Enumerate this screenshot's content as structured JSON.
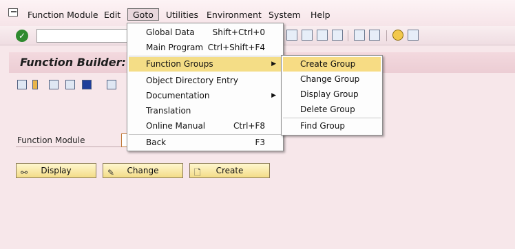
{
  "menubar": {
    "items": [
      {
        "label": "Function Module",
        "accel": "F",
        "rest": "unction Module"
      },
      {
        "label": "Edit",
        "accel": "E",
        "rest": "dit"
      },
      {
        "label": "Goto",
        "accel": "G",
        "rest": "oto"
      },
      {
        "label": "Utilities",
        "accel": "U",
        "rest": "tilities"
      },
      {
        "label": "Environment",
        "accel": "n",
        "pre": "E",
        "rest": "vironment"
      },
      {
        "label": "System",
        "accel": "S",
        "rest": "ystem"
      },
      {
        "label": "Help",
        "accel": "H",
        "rest": "elp"
      }
    ]
  },
  "page": {
    "title": "Function Builder: "
  },
  "form": {
    "function_module_label": "Function Module",
    "function_module_value": ""
  },
  "buttons": {
    "display": "Display",
    "change": "Change",
    "create": "Create"
  },
  "goto_menu": {
    "items": [
      {
        "label": "Global Data",
        "shortcut": "Shift+Ctrl+0"
      },
      {
        "label": "Main Program",
        "shortcut": "Ctrl+Shift+F4"
      },
      {
        "label": "Function Groups",
        "shortcut": "",
        "submenu": true
      },
      {
        "label": "Object Directory Entry",
        "shortcut": ""
      },
      {
        "label": "Documentation",
        "shortcut": "",
        "submenu": true
      },
      {
        "label": "Translation",
        "shortcut": ""
      },
      {
        "label": "Online Manual",
        "shortcut": "Ctrl+F8"
      },
      {
        "label": "Back",
        "shortcut": "F3"
      }
    ]
  },
  "group_menu": {
    "items": [
      {
        "label": "Create Group"
      },
      {
        "label": "Change Group"
      },
      {
        "label": "Display Group"
      },
      {
        "label": "Delete Group"
      },
      {
        "label": "Find Group"
      }
    ]
  },
  "colors": {
    "background": "#f7e7ea",
    "highlight": "#f7dc84",
    "button": "#f3dc87"
  }
}
